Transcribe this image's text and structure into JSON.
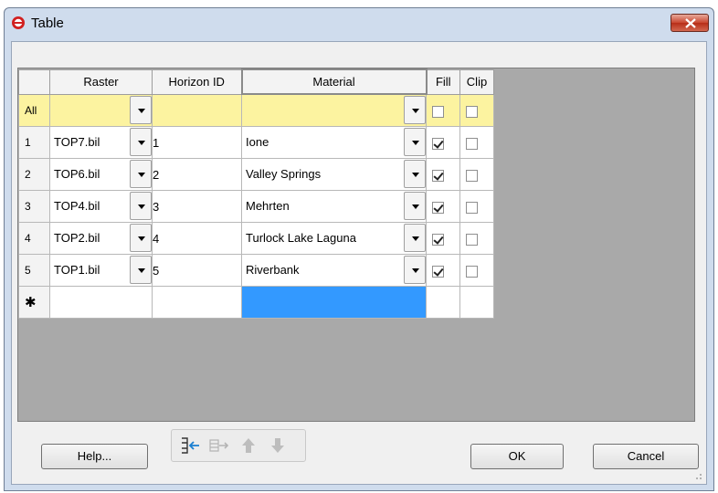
{
  "window": {
    "title": "Table",
    "icon": "app-logo-icon"
  },
  "grid": {
    "columns": [
      "Raster",
      "Horizon ID",
      "Material",
      "Fill",
      "Clip"
    ],
    "all_row_label": "All",
    "new_row_label": "✱",
    "rows": [
      {
        "num": "1",
        "raster": "TOP7.bil",
        "horizon_id": "1",
        "material": "Ione",
        "fill": true,
        "clip": false
      },
      {
        "num": "2",
        "raster": "TOP6.bil",
        "horizon_id": "2",
        "material": "Valley Springs",
        "fill": true,
        "clip": false
      },
      {
        "num": "3",
        "raster": "TOP4.bil",
        "horizon_id": "3",
        "material": "Mehrten",
        "fill": true,
        "clip": false
      },
      {
        "num": "4",
        "raster": "TOP2.bil",
        "horizon_id": "4",
        "material": "Turlock Lake Laguna",
        "fill": true,
        "clip": false
      },
      {
        "num": "5",
        "raster": "TOP1.bil",
        "horizon_id": "5",
        "material": "Riverbank",
        "fill": true,
        "clip": false
      }
    ]
  },
  "buttons": {
    "help": "Help...",
    "ok": "OK",
    "cancel": "Cancel"
  },
  "toolbar": [
    "insert-row-icon",
    "add-row-icon",
    "move-up-icon",
    "move-down-icon"
  ],
  "colors": {
    "all_row": "#fcf3a0",
    "selection": "#3399ff",
    "grid_bg": "#a9a9a9"
  }
}
